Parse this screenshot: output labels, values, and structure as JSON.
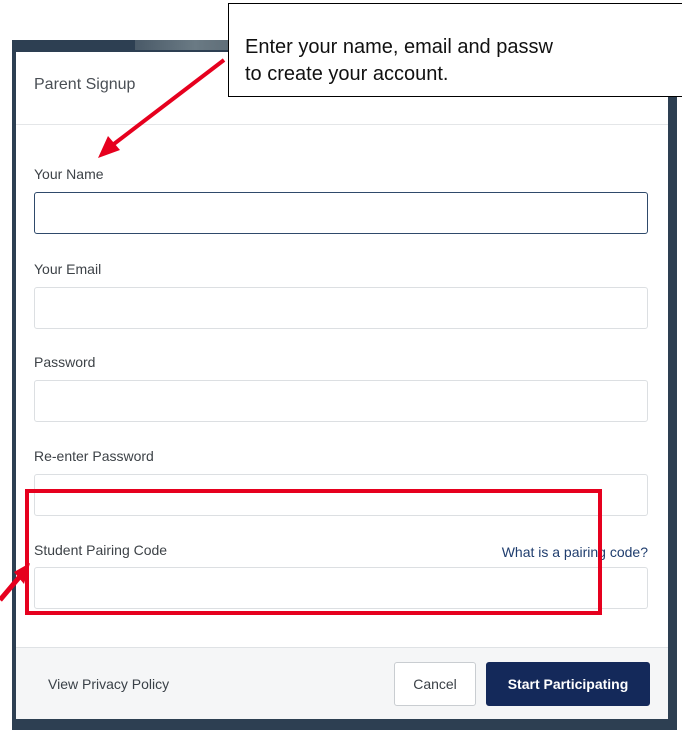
{
  "modal": {
    "title": "Parent Signup",
    "fields": [
      {
        "label": "Your Name",
        "value": "",
        "placeholder": ""
      },
      {
        "label": "Your Email",
        "value": "",
        "placeholder": ""
      },
      {
        "label": "Password",
        "value": "",
        "placeholder": ""
      },
      {
        "label": "Re-enter Password",
        "value": "",
        "placeholder": ""
      },
      {
        "label": "Student Pairing Code",
        "value": "",
        "placeholder": ""
      }
    ],
    "pairing_help_link": "What is a pairing code?"
  },
  "footer": {
    "privacy_link": "View Privacy Policy",
    "cancel_label": "Cancel",
    "submit_label": "Start Participating"
  },
  "annotation": {
    "callout_text": "Enter your name, email and passw\nto create your account.",
    "highlight_color": "#e6001e",
    "arrow_color": "#e6001e"
  },
  "colors": {
    "primary": "#14295a",
    "backdrop": "#2d3f52"
  }
}
